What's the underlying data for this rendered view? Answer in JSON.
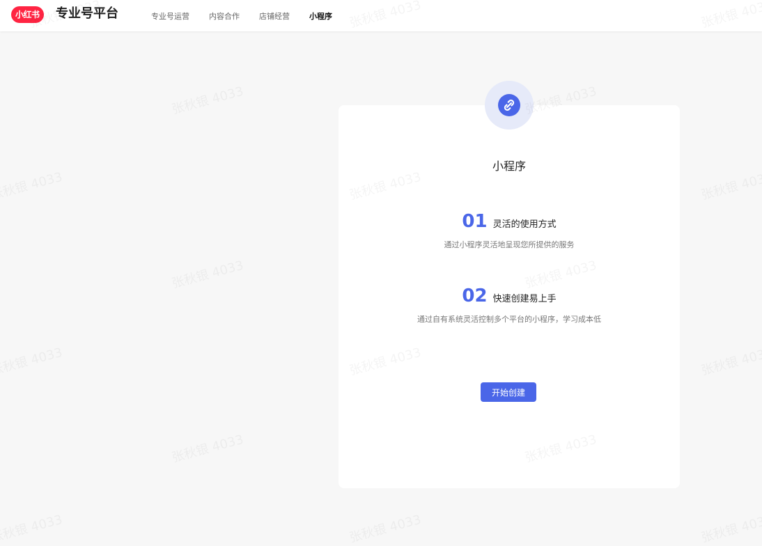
{
  "header": {
    "logo_text": "小红书",
    "platform_title": "专业号平台",
    "nav": [
      {
        "label": "专业号运营",
        "active": false
      },
      {
        "label": "内容合作",
        "active": false
      },
      {
        "label": "店铺经营",
        "active": false
      },
      {
        "label": "小程序",
        "active": true
      }
    ]
  },
  "watermark_text": "张秋银 4033",
  "card": {
    "icon": "link-icon",
    "title": "小程序",
    "features": [
      {
        "number": "01",
        "title": "灵活的使用方式",
        "description": "通过小程序灵活地呈现您所提供的服务"
      },
      {
        "number": "02",
        "title": "快速创建易上手",
        "description": "通过自有系统灵活控制多个平台的小程序，学习成本低"
      }
    ],
    "button_label": "开始创建"
  },
  "colors": {
    "brand_red": "#ff2442",
    "accent_blue": "#4a66e8",
    "icon_bg": "#e6eaf9",
    "page_bg": "#f7f7f7"
  }
}
